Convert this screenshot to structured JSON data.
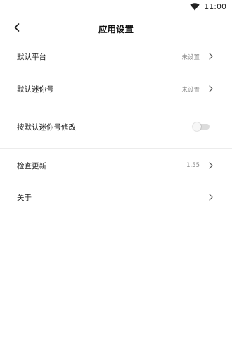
{
  "status_bar": {
    "time": "11:00",
    "wifi_icon": "wifi-icon"
  },
  "header": {
    "back_icon": "back-chevron-icon",
    "title": "应用设置"
  },
  "settings": {
    "default_platform": {
      "label": "默认平台",
      "value": "未设置"
    },
    "default_mini_id": {
      "label": "默认迷你号",
      "value": "未设置"
    },
    "edit_by_default_mini_id": {
      "label": "按默认迷你号修改",
      "toggle_on": false
    },
    "check_update": {
      "label": "检查更新",
      "value": "1.55"
    },
    "about": {
      "label": "关于"
    }
  },
  "colors": {
    "background": "#ffffff",
    "text": "#222222",
    "secondary_text": "#8a8a8a",
    "divider": "#ececec",
    "toggle_track": "#dcdcdc"
  }
}
